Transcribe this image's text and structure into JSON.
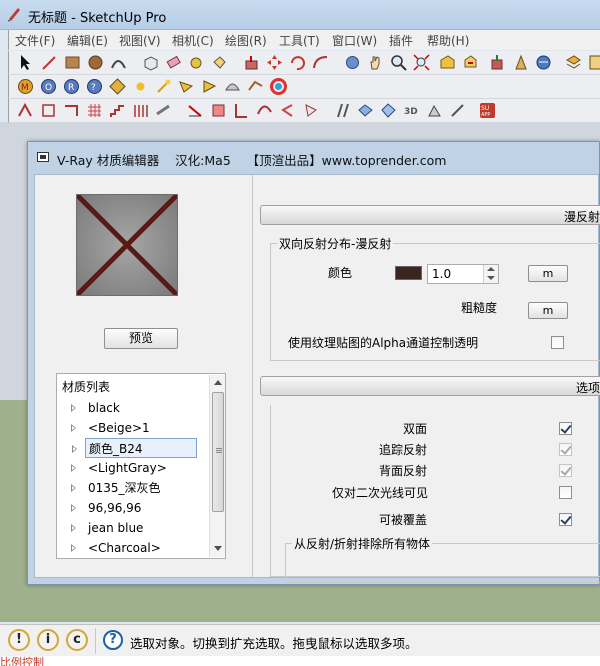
{
  "app": {
    "title": "无标题 - SketchUp Pro",
    "menus": [
      "文件(F)",
      "编辑(E)",
      "视图(V)",
      "相机(C)",
      "绘图(R)",
      "工具(T)",
      "窗口(W)",
      "插件",
      "帮助(H)"
    ]
  },
  "dialog": {
    "title": "V-Ray 材质编辑器    汉化:Ma5    【顶渲出品】www.toprender.com",
    "preview_button": "预览",
    "material_list": {
      "header": "材质列表",
      "items": [
        "black",
        "<Beige>1",
        "颜色_B24",
        "<LightGray>",
        "0135_深灰色",
        "96,96,96",
        "jean blue",
        "<Charcoal>"
      ],
      "selected_index": 2
    },
    "diffuse": {
      "rollout_label": "漫反射",
      "group_title": "双向反射分布-漫反射",
      "color_label": "颜色",
      "color_swatch": "#3a2620",
      "color_value": "1.0",
      "map_button": "m",
      "roughness_label": "粗糙度",
      "roughness_map_button": "m",
      "alpha_label": "使用纹理贴图的Alpha通道控制透明",
      "alpha_checked": false
    },
    "options": {
      "rollout_label": "选项",
      "rows": [
        {
          "label": "双面",
          "checked": true,
          "disabled": false
        },
        {
          "label": "追踪反射",
          "checked": true,
          "disabled": true
        },
        {
          "label": "背面反射",
          "checked": true,
          "disabled": true
        },
        {
          "label": "仅对二次光线可见",
          "checked": false,
          "disabled": false
        },
        {
          "label": "可被覆盖",
          "checked": true,
          "disabled": false
        }
      ],
      "exclude_group_title": "从反射/折射排除所有物体"
    }
  },
  "statusbar": {
    "text": "选取对象。切换到扩充选取。拖曳鼠标以选取多项。",
    "bottom_text": "比例控制"
  },
  "colors": {
    "accent": "#1d5fa8",
    "swatch": "#3a2620"
  }
}
